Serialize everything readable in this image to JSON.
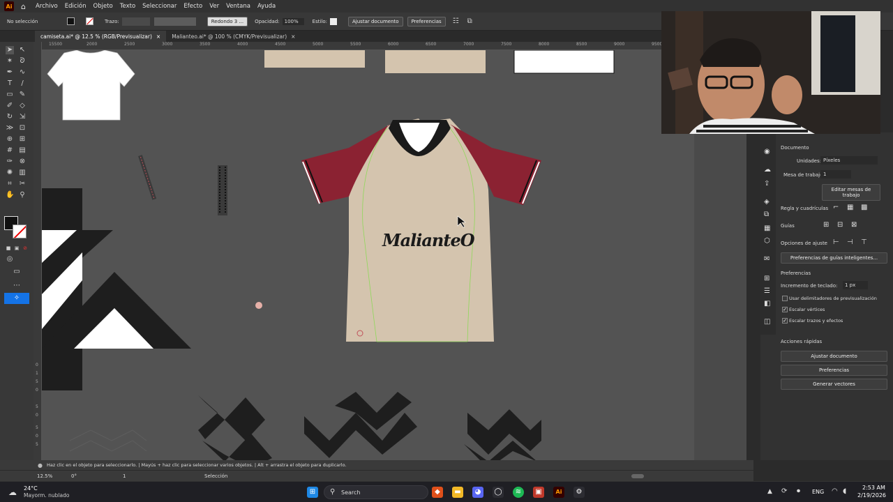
{
  "menubar": {
    "app_logo": "Ai",
    "items": [
      "Archivo",
      "Edición",
      "Objeto",
      "Texto",
      "Seleccionar",
      "Efecto",
      "Ver",
      "Ventana",
      "Ayuda"
    ]
  },
  "controlbar": {
    "selection": "No selección",
    "stroke_label": "Trazo:",
    "brush_label": "Redondo 3 ...",
    "opacity_label": "Opacidad:",
    "opacity_value": "100%",
    "style_label": "Estilo:",
    "fit_doc": "Ajustar documento",
    "prefs": "Preferencias"
  },
  "tabs": [
    {
      "label": "camiseta.ai* @ 12.5 % (RGB/Previsualizar)",
      "close": "×"
    },
    {
      "label": "Malianteo.ai* @ 100 % (CMYK/Previsualizar)",
      "close": "×"
    }
  ],
  "ruler": {
    "h_ticks": [
      "15500",
      "2000",
      "2500",
      "3000",
      "3500",
      "4000",
      "4500",
      "5000",
      "5500",
      "6000",
      "6500",
      "7000",
      "7500",
      "8000",
      "8500",
      "9000",
      "9500"
    ],
    "v_ticks": [
      "0",
      "1",
      "5",
      "0",
      "5",
      "0",
      "5",
      "0",
      "5"
    ]
  },
  "canvas": {
    "jersey_logo": "MalianteO",
    "colors": {
      "body": "#d4c4ae",
      "sleeve": "#8b2232",
      "collar": "#1a1a1a",
      "guide": "#8fd85a"
    }
  },
  "panel": {
    "title": "Documento",
    "units_label": "Unidades:",
    "units_value": "Píxeles",
    "artboard_label": "Mesa de trabajo:",
    "artboard_value": "1",
    "edit_artboards": "Editar mesas de trabajo",
    "ruler_grids": "Regla y cuadrículas",
    "guides": "Guías",
    "snap_options": "Opciones de ajuste",
    "smart_guides": "Preferencias de guías inteligentes...",
    "prefs_header": "Preferencias",
    "keyboard_inc_label": "Incremento de teclado:",
    "keyboard_inc_value": "1 px",
    "chk_preview_bounds": "Usar delimitadores de previsualización",
    "chk_scale_corners": "Escalar vértices",
    "chk_scale_strokes": "Escalar trazos y efectos",
    "quick_actions": "Acciones rápidas",
    "btn_fit": "Ajustar documento",
    "btn_prefs": "Preferencias",
    "btn_vectors": "Generar vectores"
  },
  "status": {
    "hint": "Haz clic en el objeto para seleccionarlo. | Mayús + haz clic para seleccionar varios objetos. | Alt + arrastra el objeto para duplicarlo.",
    "zoom": "12.5%",
    "rotation": "0°",
    "artboard": "1",
    "mode": "Selección"
  },
  "taskbar": {
    "weather_temp": "24°C",
    "weather_desc": "Mayorm. nublado",
    "search": "Search",
    "lang": "ENG",
    "time": "2:53 AM",
    "date": "2/19/2026"
  }
}
